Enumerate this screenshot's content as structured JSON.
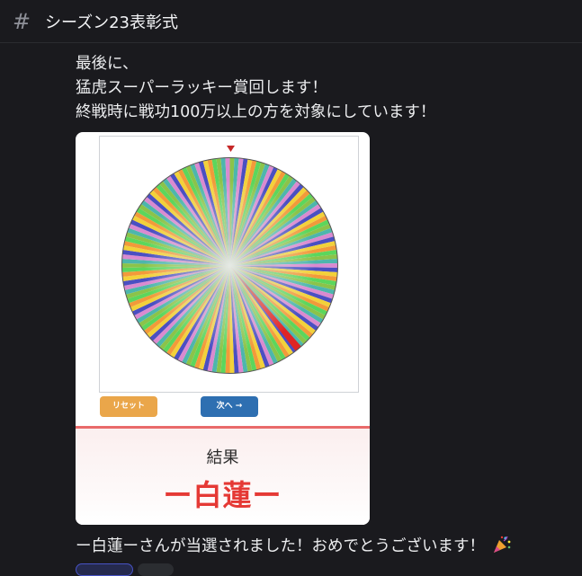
{
  "channel": {
    "hash_symbol": "#",
    "title": "シーズン23表彰式"
  },
  "message": {
    "lines": [
      "最後に、",
      "猛虎スーパーラッキー賞回します！",
      "終戦時に戦功100万以上の方を対象にしています！"
    ],
    "winner_line": "ー白蓮ーさんが当選されました！おめでとうございます！"
  },
  "roulette": {
    "reset_label": "リセット",
    "next_label": "次へ →",
    "result_label": "結果",
    "result_name": "ー白蓮ー",
    "segment_count": 150,
    "palette": [
      "#8bc34a",
      "#4db6ac",
      "#d98ad0",
      "#4a4fc2",
      "#f2d13a",
      "#f29a3a",
      "#5cd65c"
    ],
    "winner_color": "#e02424",
    "result_color": "#e53935",
    "accent_border": "#e96a6a"
  },
  "icons": {
    "pointer": "triangle-pointer-icon",
    "party": "party-popper-icon"
  }
}
